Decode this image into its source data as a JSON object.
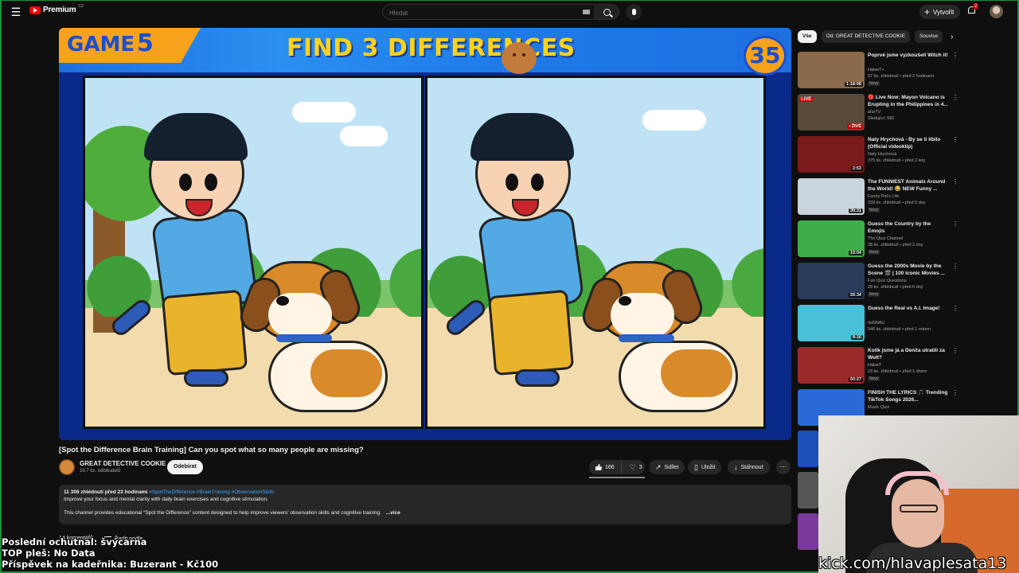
{
  "header": {
    "logo_text": "Premium",
    "logo_region": "CZ",
    "search_placeholder": "Hledat",
    "create_label": "Vytvořit",
    "notifications_count": "2"
  },
  "player": {
    "game_label": "GAME",
    "game_number": "5",
    "headline": "FIND 3 DIFFERENCES",
    "timer": "35"
  },
  "video": {
    "title": "[Spot the Difference Brain Training] Can you spot what so many people are missing?",
    "channel_name": "GREAT DETECTIVE COOKIE",
    "channel_subs": "16,7 tis. odběratelů",
    "subscribe_label": "Odebírat",
    "likes": "166",
    "dislikes": "3",
    "share_label": "Sdílet",
    "save_label": "Uložit",
    "download_label": "Stáhnout"
  },
  "description": {
    "stats": "11 306 zhlédnutí  před 23 hodinami",
    "tags": "#SpotTheDifference #BrainTraining #ObservationSkills",
    "line1": "Improve your focus and mental clarity with daily brain exercises and cognitive stimulation.",
    "line2": "This channel provides educational “Spot the Difference” content designed to help improve viewers' observation skills and cognitive training.",
    "more": "...více"
  },
  "comments": {
    "count_label": "14 komentářů",
    "sort_label": "Řadit podle"
  },
  "overlay": {
    "line1": "Poslední ochutnal: švýcarna",
    "line2": "TOP pleš: No Data",
    "line3": "Příspěvek na kadeřnika: Buzerant - Kč100"
  },
  "sidebar": {
    "chips": [
      "Vše",
      "Od: GREAT DETECTIVE COOKIE",
      "Souvise"
    ],
    "items": [
      {
        "title": "Poprvé jsme vyzkoušeli Witch it!",
        "channel": "HalseT+",
        "meta": "57 tis. zhlédnutí • před 2 hodinami",
        "badge": "Nový",
        "duration": "1:18:08",
        "thumb_color": "#8a6a4a"
      },
      {
        "title": "🔴 Live Now: Mayon Volcano is Erupting in the Philippines in 4...",
        "channel": "afarTV",
        "meta": "Sledující: 682",
        "badge": "",
        "duration": "• ŽIVĚ",
        "thumb_color": "#5a4a3a",
        "live": "LIVE"
      },
      {
        "title": "Naty Hrychová - By se ti líbilo (Official videoklip)",
        "channel": "Naty Hrychová",
        "meta": "375 tis. zhlédnutí • před 2 lety",
        "badge": "",
        "duration": "2:53",
        "thumb_color": "#7a1a1a"
      },
      {
        "title": "The FUNNIEST Animals Around the World! 😂 NEW Funny ...",
        "channel": "Funny Pet's Life",
        "meta": "328 tis. zhlédnutí • před 5 dny",
        "badge": "Nový",
        "duration": "30:31",
        "thumb_color": "#c9d4dc"
      },
      {
        "title": "Guess the Country by the Emojis",
        "channel": "The Quiz Channel",
        "meta": "28 tis. zhlédnutí • před 2 dny",
        "badge": "Nový",
        "duration": "10:04",
        "thumb_color": "#3fae4a"
      },
      {
        "title": "Guess the 2000s Movie by the Scene 🎬 | 100 Iconic Movies ...",
        "channel": "Fun Quiz Questions",
        "meta": "28 tis. zhlédnutí • před 6 dny",
        "badge": "Nový",
        "duration": "26:34",
        "thumb_color": "#2a3a5a"
      },
      {
        "title": "Guess the Real vs A.I. Image!",
        "channel": "ItsNNAU",
        "meta": "546 tis. zhlédnutí • před 1 rokem",
        "badge": "",
        "duration": "8:16",
        "thumb_color": "#4ac0d8"
      },
      {
        "title": "Kolik jsme já a Denča utratili za Wolt?",
        "channel": "HalseT",
        "meta": "23 tis. zhlédnutí • před 1 dnem",
        "badge": "Nový",
        "duration": "50:27",
        "thumb_color": "#9a2a2a"
      },
      {
        "title": "FINISH THE LYRICS 🎵 Trending TikTok Songs 2026...",
        "channel": "Music Quiz",
        "meta": "",
        "badge": "",
        "duration": "",
        "thumb_color": "#2a6ad8"
      }
    ]
  },
  "stream": {
    "kick_url": "kick.com/hlavaplesata13"
  },
  "colors": {
    "background": "#0f0f0f",
    "accent_red": "#ff0000",
    "link_blue": "#3ea6ff",
    "banner_blue": "#1e6fe0",
    "banner_orange": "#f7a21b"
  }
}
